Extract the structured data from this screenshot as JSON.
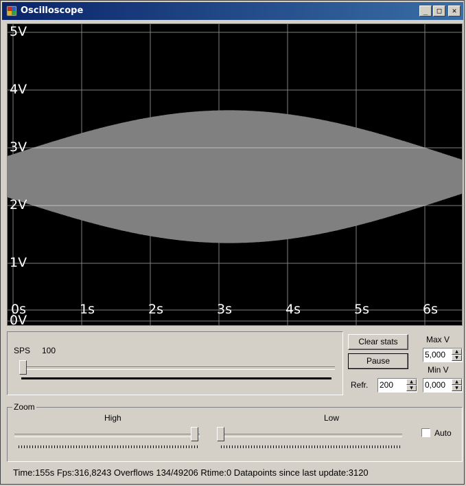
{
  "window": {
    "title": "Oscilloscope",
    "minimize": "_",
    "maximize": "□",
    "close": "✕"
  },
  "scope": {
    "y_labels": [
      "5V",
      "4V",
      "3V",
      "2V",
      "1V",
      "0V"
    ],
    "x_labels": [
      "0s",
      "1s",
      "2s",
      "3s",
      "4s",
      "5s",
      "6s"
    ],
    "background": "#000000",
    "trace_color": "#ffffff",
    "grid_color": "#808080"
  },
  "sps": {
    "label": "SPS",
    "value": "100"
  },
  "buttons": {
    "clear_stats": "Clear stats",
    "pause": "Pause"
  },
  "max_v": {
    "label": "Max V",
    "value": "5,000"
  },
  "min_v": {
    "label": "Min V",
    "value": "0,000"
  },
  "refresh": {
    "label": "Refr.",
    "value": "200"
  },
  "zoom": {
    "caption": "Zoom",
    "high_label": "High",
    "low_label": "Low",
    "auto_label": "Auto",
    "auto_checked": false
  },
  "status": "Time:155s Fps:316,8243 Overflows 134/49206 Rtime:0 Datapoints since last update:3120"
}
